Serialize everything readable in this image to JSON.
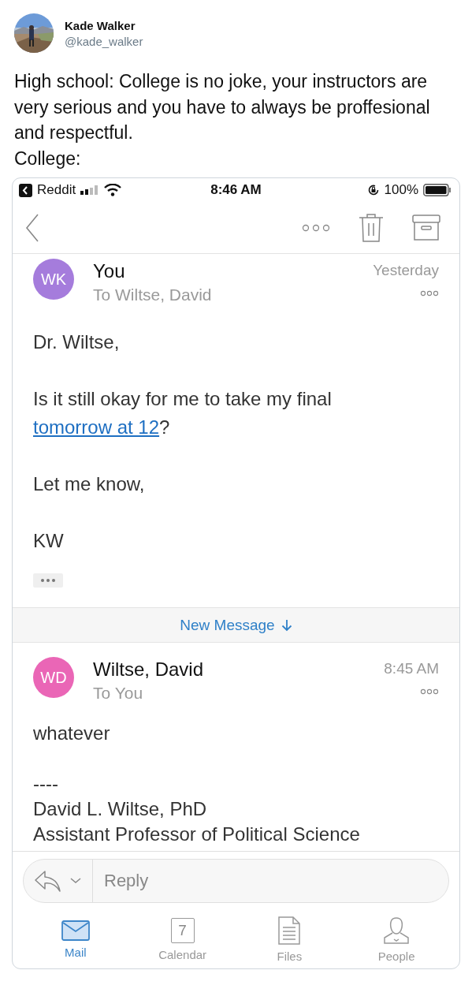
{
  "tweet": {
    "author": {
      "name": "Kade Walker",
      "handle": "@kade_walker"
    },
    "paragraphs": [
      "High school: College is no joke, your instructors are very serious and you have to always be proffesional and respectful.",
      "College:"
    ]
  },
  "phone": {
    "status_bar": {
      "back_app": "Reddit",
      "time": "8:46 AM",
      "battery": "100%"
    },
    "messages": [
      {
        "initials": "WK",
        "color": "#a57cdc",
        "sender": "You",
        "recipients": "To Wiltse, David",
        "time": "Yesterday",
        "body": [
          {
            "kind": "text",
            "text": "Dr. Wiltse,"
          },
          {
            "kind": "link_text",
            "before": "Is it still okay for me to take my final ",
            "link": "tomorrow at 12",
            "after": "?"
          },
          {
            "kind": "text",
            "text": "Let me know,"
          },
          {
            "kind": "text",
            "text": "KW"
          },
          {
            "kind": "quoted_toggle"
          }
        ]
      },
      {
        "initials": "WD",
        "color": "#ea66b6",
        "sender": "Wiltse, David",
        "recipients": "To You",
        "time": "8:45 AM",
        "body": [
          {
            "kind": "text",
            "text": "whatever"
          },
          {
            "kind": "signature",
            "lines": [
              "----",
              "David L. Wiltse, PhD",
              "Assistant Professor of Political Science"
            ]
          }
        ]
      }
    ],
    "new_message_divider": "New Message",
    "reply_field": {
      "placeholder": "Reply"
    },
    "tabs": [
      {
        "kind": "mail",
        "label": "Mail",
        "selected": true
      },
      {
        "kind": "calendar",
        "label": "Calendar",
        "day": "7",
        "selected": false
      },
      {
        "kind": "files",
        "label": "Files",
        "selected": false
      },
      {
        "kind": "people",
        "label": "People",
        "selected": false
      }
    ]
  }
}
